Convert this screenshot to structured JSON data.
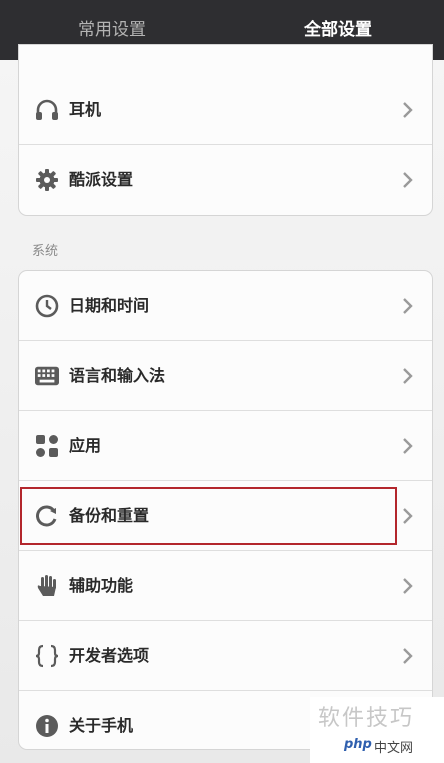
{
  "tabs": {
    "common_label": "常用设置",
    "all_label": "全部设置",
    "selected": "全部设置"
  },
  "group1": {
    "items": [
      {
        "label": "耳机",
        "icon": "headphones-icon"
      },
      {
        "label": "酷派设置",
        "icon": "gear-icon"
      }
    ]
  },
  "system": {
    "title": "系统",
    "items": [
      {
        "label": "日期和时间",
        "icon": "clock-icon"
      },
      {
        "label": "语言和输入法",
        "icon": "keyboard-icon"
      },
      {
        "label": "应用",
        "icon": "apps-icon"
      },
      {
        "label": "备份和重置",
        "icon": "backup-icon"
      },
      {
        "label": "辅助功能",
        "icon": "hand-icon"
      },
      {
        "label": "开发者选项",
        "icon": "braces-icon"
      },
      {
        "label": "关于手机",
        "icon": "info-icon"
      }
    ],
    "highlighted_item": "备份和重置"
  },
  "watermark": {
    "text": "软件技巧",
    "logo": "php",
    "site": "中文网"
  },
  "colors": {
    "tabbar": "#2e2e31",
    "highlight": "#b3262c",
    "icon": "#5b5b5b"
  }
}
